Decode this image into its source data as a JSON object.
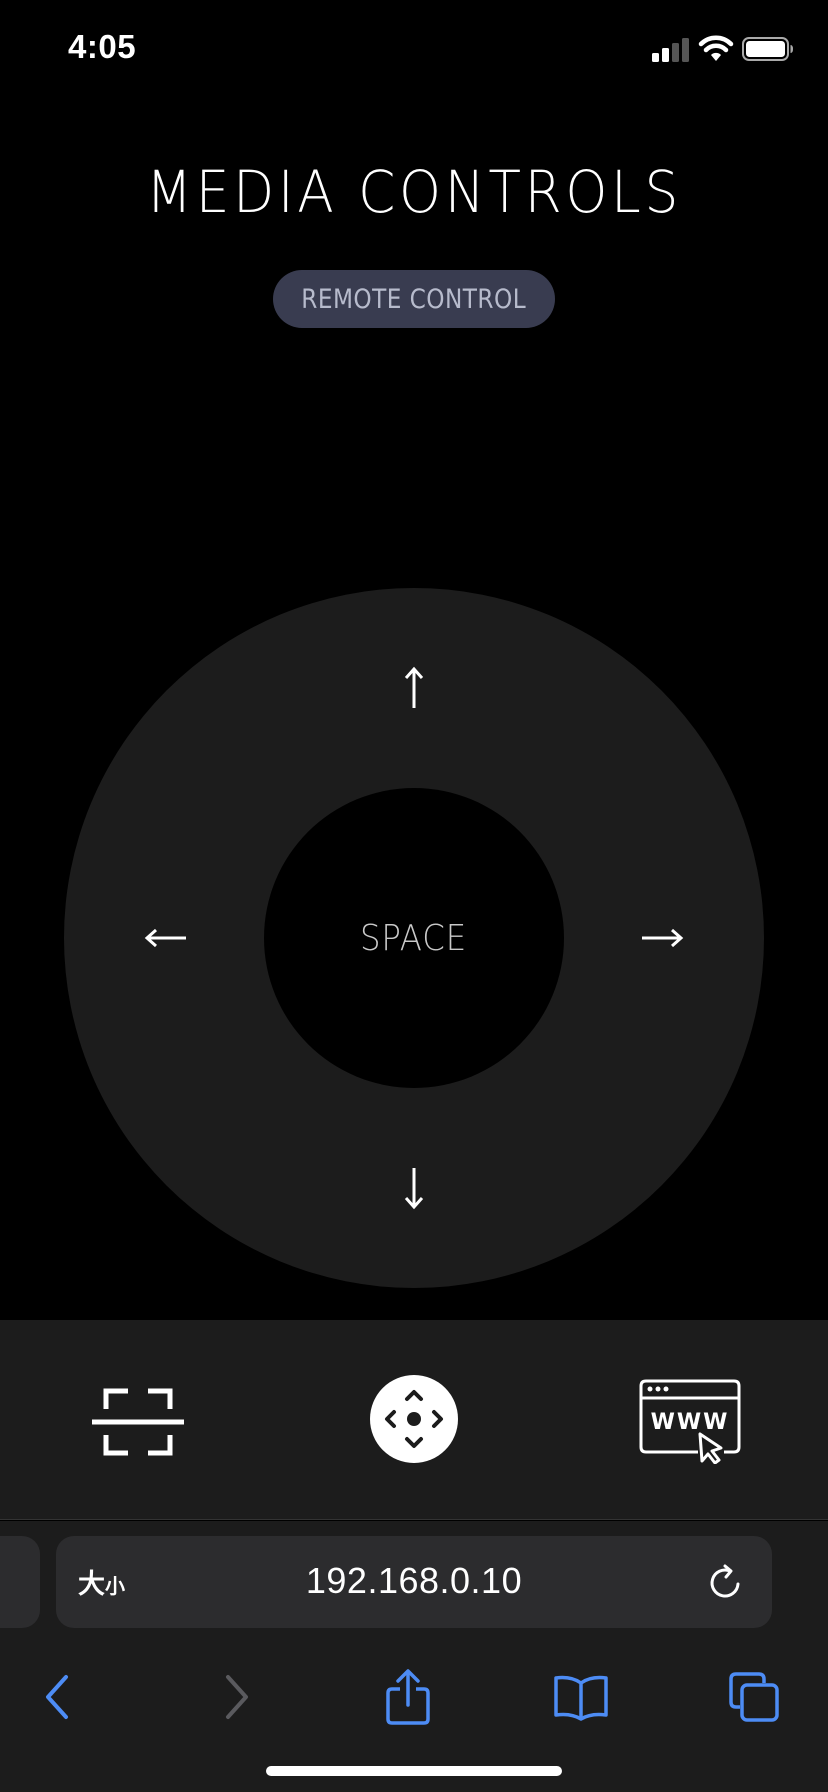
{
  "status_bar": {
    "time": "4:05",
    "icons": [
      "cellular-signal-icon",
      "wifi-icon",
      "battery-icon"
    ]
  },
  "header": {
    "title": "MEDIA CONTROLS",
    "mode_badge": "REMOTE CONTROL"
  },
  "dpad": {
    "up_icon": "arrow-up-icon",
    "down_icon": "arrow-down-icon",
    "left_icon": "arrow-left-icon",
    "right_icon": "arrow-right-icon",
    "center_label": "SPACE"
  },
  "toolbar": {
    "items": [
      "fullscreen-icon",
      "dpad-icon",
      "web-browser-icon"
    ]
  },
  "browser": {
    "text_size_label_large": "大",
    "text_size_label_small": "小",
    "url": "192.168.0.10",
    "nav_icons": [
      "back-icon",
      "forward-icon",
      "share-icon",
      "bookmarks-icon",
      "tabs-icon"
    ]
  },
  "colors": {
    "background": "#000000",
    "panel": "#1c1c1c",
    "badge": "#393c50",
    "accent_blue": "#4d8cf5"
  }
}
